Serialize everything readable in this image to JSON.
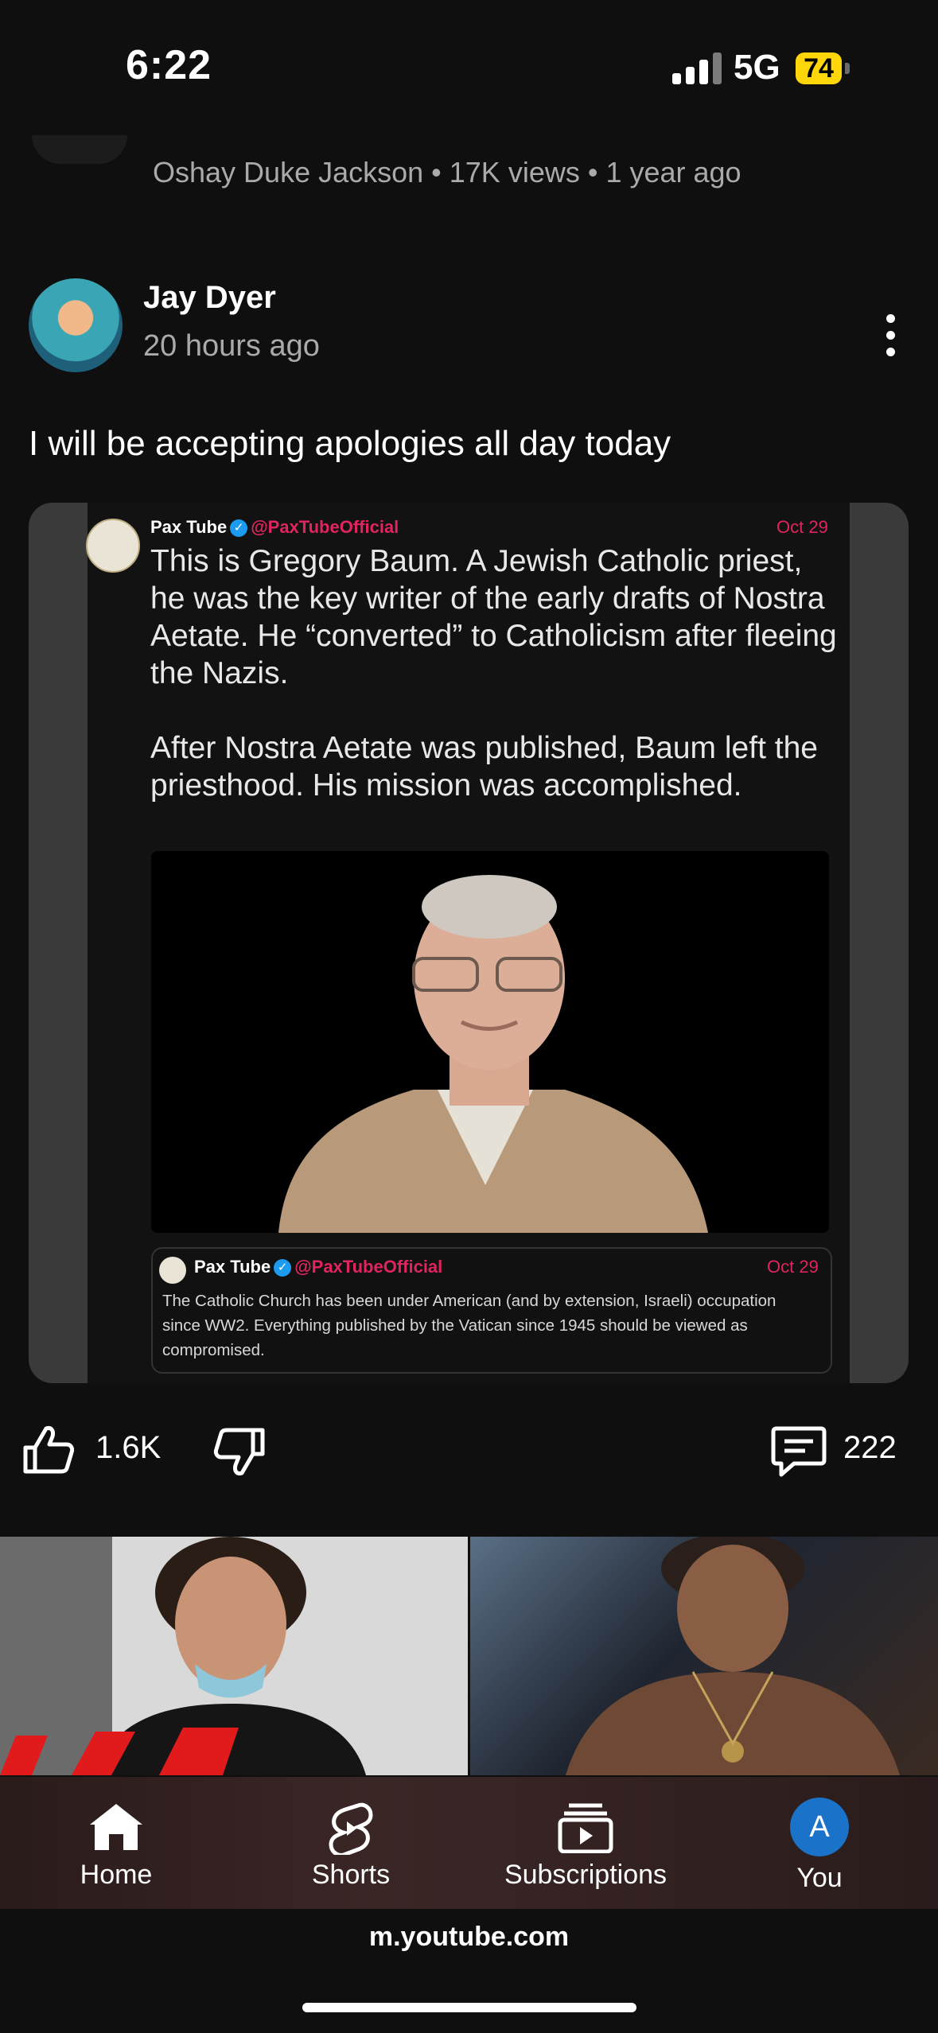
{
  "status": {
    "time": "6:22",
    "network": "5G",
    "battery": "74"
  },
  "previous_video": {
    "meta": "Oshay Duke Jackson • 17K views • 1 year ago"
  },
  "post": {
    "channel": "Jay Dyer",
    "time": "20 hours ago",
    "text": "I will be accepting apologies all day today",
    "likes": "1.6K",
    "comments": "222"
  },
  "tweet": {
    "name": "Pax Tube",
    "handle": "@PaxTubeOfficial",
    "date": "Oct 29",
    "text": "This is Gregory Baum. A Jewish Catholic priest, he was the key writer of the early drafts of Nostra Aetate. He “converted” to Catholicism after fleeing the Nazis.\n\nAfter Nostra Aetate was published, Baum left the priesthood. His mission was accomplished.",
    "quote": {
      "name": "Pax Tube",
      "handle": "@PaxTubeOfficial",
      "date": "Oct 29",
      "text": "The Catholic Church has been under American (and by extension, Israeli) occupation since WW2. Everything published by the Vatican since 1945 should be viewed as compromised."
    }
  },
  "nav": {
    "home": "Home",
    "shorts": "Shorts",
    "subscriptions": "Subscriptions",
    "you": "You",
    "avatar_letter": "A"
  },
  "browser": {
    "url": "m.youtube.com"
  },
  "colors": {
    "background": "#0f0f0f",
    "muted": "#aaaaaa",
    "tweet_accent": "#e0245e",
    "verified": "#1d9bf0"
  }
}
